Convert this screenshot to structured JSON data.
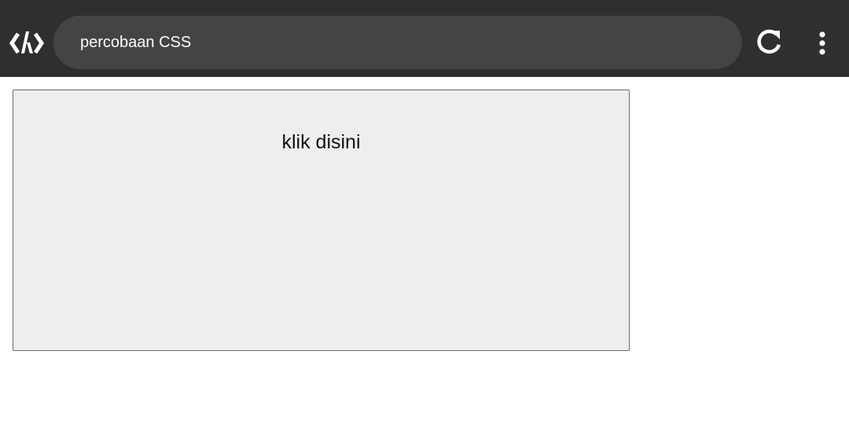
{
  "browser": {
    "logo_icon": "code-brackets-logo-icon",
    "address_text": "percobaan CSS",
    "reload_icon": "reload-icon",
    "menu_icon": "more-vert-icon",
    "toolbar_color": "#2f2f2f",
    "address_bar_color": "#444444"
  },
  "page": {
    "box_label": "klik disini",
    "box_color": "#eeeeee"
  }
}
